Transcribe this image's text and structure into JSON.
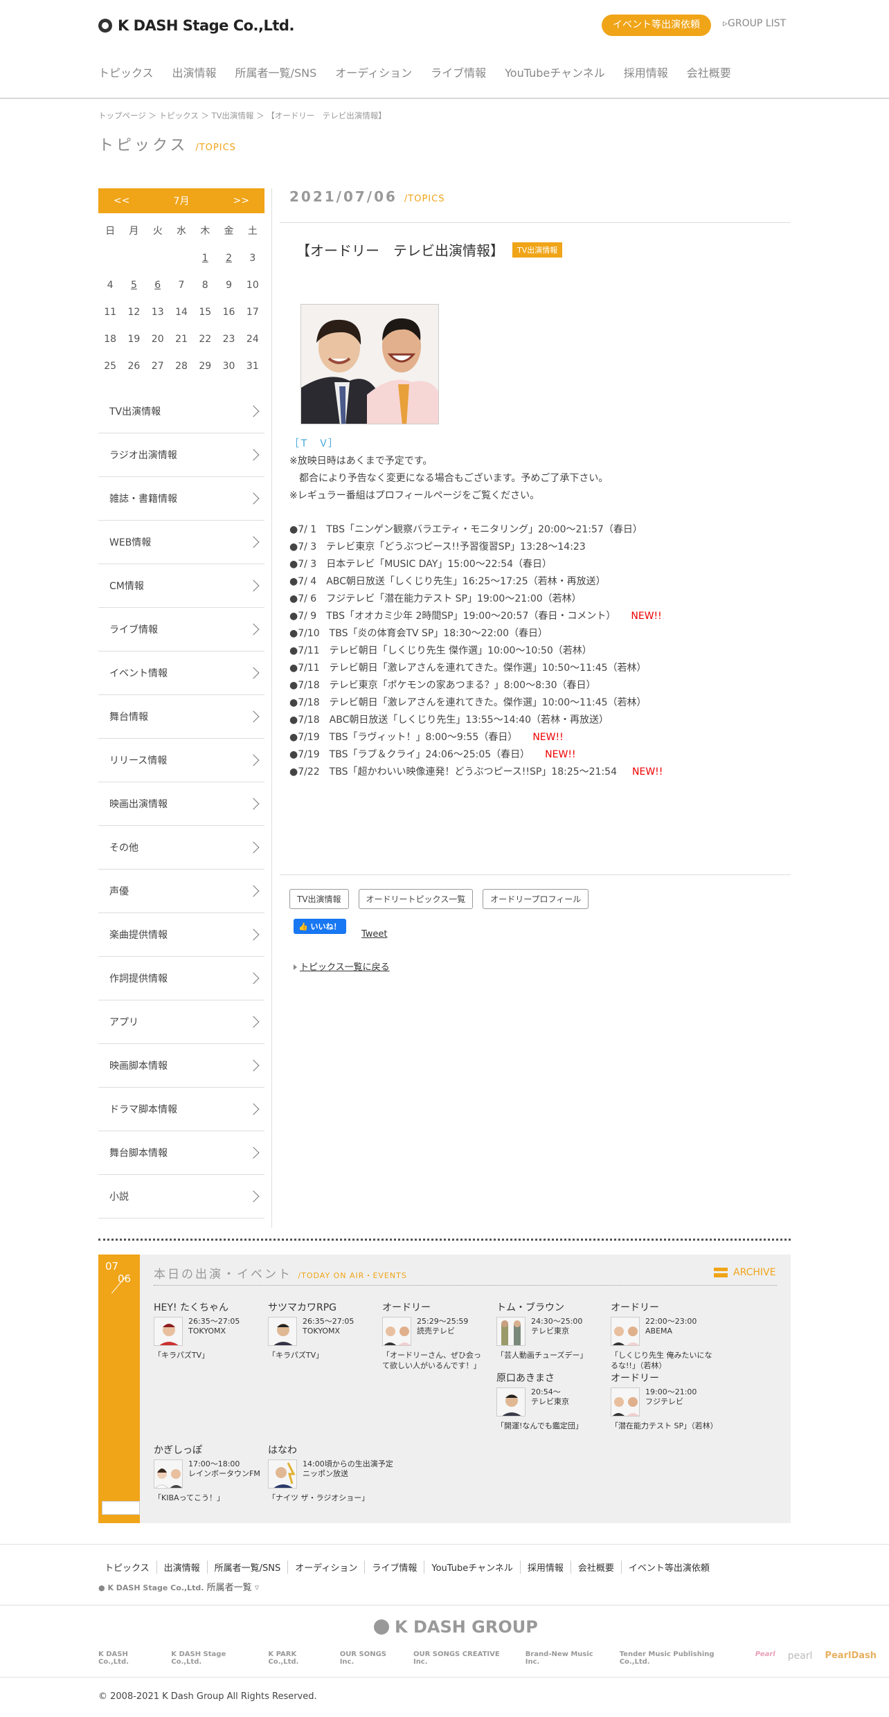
{
  "header": {
    "logo": "K DASH Stage Co.,Ltd.",
    "event_button": "イベント等出演依頼",
    "group_list": "GROUP LIST",
    "nav": [
      "トピックス",
      "出演情報",
      "所属者一覧/SNS",
      "オーディション",
      "ライブ情報",
      "YouTubeチャンネル",
      "採用情報",
      "会社概要"
    ]
  },
  "breadcrumb": "トップページ ＞ トピックス ＞ TV出演情報 ＞ 【オードリー　テレビ出演情報】",
  "page_title": "トピックス",
  "page_title_en": "/TOPICS",
  "calendar": {
    "prev": "<<",
    "month": "7月",
    "next": ">>",
    "weekdays": [
      "日",
      "月",
      "火",
      "水",
      "木",
      "金",
      "土"
    ],
    "weeks": [
      [
        "",
        "",
        "",
        "",
        "1",
        "2",
        "3"
      ],
      [
        "4",
        "5",
        "6",
        "7",
        "8",
        "9",
        "10"
      ],
      [
        "11",
        "12",
        "13",
        "14",
        "15",
        "16",
        "17"
      ],
      [
        "18",
        "19",
        "20",
        "21",
        "22",
        "23",
        "24"
      ],
      [
        "25",
        "26",
        "27",
        "28",
        "29",
        "30",
        "31"
      ]
    ]
  },
  "categories": [
    "TV出演情報",
    "ラジオ出演情報",
    "雑誌・書籍情報",
    "WEB情報",
    "CM情報",
    "ライブ情報",
    "イベント情報",
    "舞台情報",
    "リリース情報",
    "映画出演情報",
    "その他",
    "声優",
    "楽曲提供情報",
    "作詞提供情報",
    "アプリ",
    "映画脚本情報",
    "ドラマ脚本情報",
    "舞台脚本情報",
    "小説"
  ],
  "article": {
    "date": "2021/07/06",
    "date_en": "/TOPICS",
    "title": "【オードリー　テレビ出演情報】",
    "tag": "TV出演情報",
    "tv_label": "［Ｔ　Ｖ］",
    "notes": [
      "※放映日時はあくまで予定です。",
      "　都合により予告なく変更になる場合もございます。予めご了承下さい。",
      "※レギュラー番組はプロフィールページをご覧ください。"
    ],
    "schedule": [
      {
        "text": "●7/ 1　TBS「ニンゲン観察バラエティ・モニタリング」20:00～21:57（春日）",
        "new": ""
      },
      {
        "text": "●7/ 3　テレビ東京「どうぶつピース!!予習復習SP」13:28～14:23",
        "new": ""
      },
      {
        "text": "●7/ 3　日本テレビ「MUSIC DAY」15:00～22:54（春日）",
        "new": ""
      },
      {
        "text": "●7/ 4　ABC朝日放送「しくじり先生」16:25～17:25（若林・再放送）",
        "new": ""
      },
      {
        "text": "●7/ 6　フジテレビ「潜在能力テスト SP」19:00～21:00（若林）",
        "new": ""
      },
      {
        "text": "●7/ 9　TBS「オオカミ少年 2時間SP」19:00～20:57（春日・コメント）",
        "new": "NEW!!"
      },
      {
        "text": "●7/10　TBS「炎の体育会TV SP」18:30～22:00（春日）",
        "new": ""
      },
      {
        "text": "●7/11　テレビ朝日「しくじり先生 傑作選」10:00～10:50（若林）",
        "new": ""
      },
      {
        "text": "●7/11　テレビ朝日「激レアさんを連れてきた。傑作選」10:50～11:45（若林）",
        "new": ""
      },
      {
        "text": "●7/18　テレビ東京「ポケモンの家あつまる？」8:00～8:30（春日）",
        "new": ""
      },
      {
        "text": "●7/18　テレビ朝日「激レアさんを連れてきた。傑作選」10:00～11:45（若林）",
        "new": ""
      },
      {
        "text": "●7/18　ABC朝日放送「しくじり先生」13:55～14:40（若林・再放送）",
        "new": ""
      },
      {
        "text": "●7/19　TBS「ラヴィット！」8:00～9:55（春日）",
        "new": "NEW!!"
      },
      {
        "text": "●7/19　TBS「ラブ＆クライ」24:06～25:05（春日）",
        "new": "NEW!!"
      },
      {
        "text": "●7/22　TBS「超かわいい映像連発！どうぶつピース!!SP」18:25～21:54",
        "new": "NEW!!"
      }
    ],
    "related": [
      "TV出演情報",
      "オードリートピックス一覧",
      "オードリープロフィール"
    ],
    "like": "いいね！",
    "tweet": "Tweet",
    "back": "トピックス一覧に戻る"
  },
  "today": {
    "month": "07",
    "day": "06",
    "title": "本日の出演・イベント",
    "title_en": "/TODAY ON AIR・EVENTS",
    "archive": "ARCHIVE",
    "events": [
      {
        "name": "HEY! たくちゃん",
        "time": "26:35～27:05\nTOKYOMX",
        "program": "「キラパズTV」"
      },
      {
        "name": "サツマカワRPG",
        "time": "26:35～27:05\nTOKYOMX",
        "program": "「キラパズTV」"
      },
      {
        "name": "オードリー",
        "time": "25:29～25:59\n読売テレビ",
        "program": "「オードリーさん、ぜひ会って欲しい人がいるんです！」"
      },
      {
        "name": "トム・ブラウン",
        "time": "24:30～25:00\nテレビ東京",
        "program": "「芸人動画チューズデー」"
      },
      {
        "name": "オードリー",
        "time": "22:00～23:00\nABEMA",
        "program": "「しくじり先生 俺みたいになるな!!」（若林）"
      },
      {
        "name": "原口あきまさ",
        "time": "20:54～\nテレビ東京",
        "program": "「開運!なんでも鑑定団」"
      },
      {
        "name": "オードリー",
        "time": "19:00～21:00\nフジテレビ",
        "program": "「潜在能力テスト SP」（若林）"
      },
      {
        "name": "かぎしっぽ",
        "time": "17:00～18:00\nレインボータウンFM",
        "program": "「KIBAってこう！」"
      },
      {
        "name": "はなわ",
        "time": "14:00頃からの生出演予定\nニッポン放送",
        "program": "「ナイツ ザ・ラジオショー」"
      }
    ]
  },
  "footer": {
    "nav": [
      "トピックス",
      "出演情報",
      "所属者一覧/SNS",
      "オーディション",
      "ライブ情報",
      "YouTubeチャンネル",
      "採用情報",
      "会社概要",
      "イベント等出演依頼"
    ],
    "sub_logo": "K DASH Stage Co.,Ltd.",
    "sub_label": "所属者一覧",
    "group_logo": "K DASH GROUP",
    "brands": [
      "K DASH Co.,Ltd.",
      "K DASH Stage Co.,Ltd.",
      "K PARK Co.,Ltd.",
      "OUR SONGS Inc.",
      "OUR SONGS CREATIVE Inc.",
      "Brand-New Music Inc.",
      "Tender Music Publishing Co.,Ltd.",
      "Pearl",
      "pearl",
      "PearlDash"
    ],
    "copyright": "© 2008-2021 K Dash Group All Rights Reserved."
  },
  "colors": {
    "accent": "#f0a417",
    "new": "#ee0000",
    "tv_label": "#3aa3d7",
    "like": "#1877f2"
  }
}
